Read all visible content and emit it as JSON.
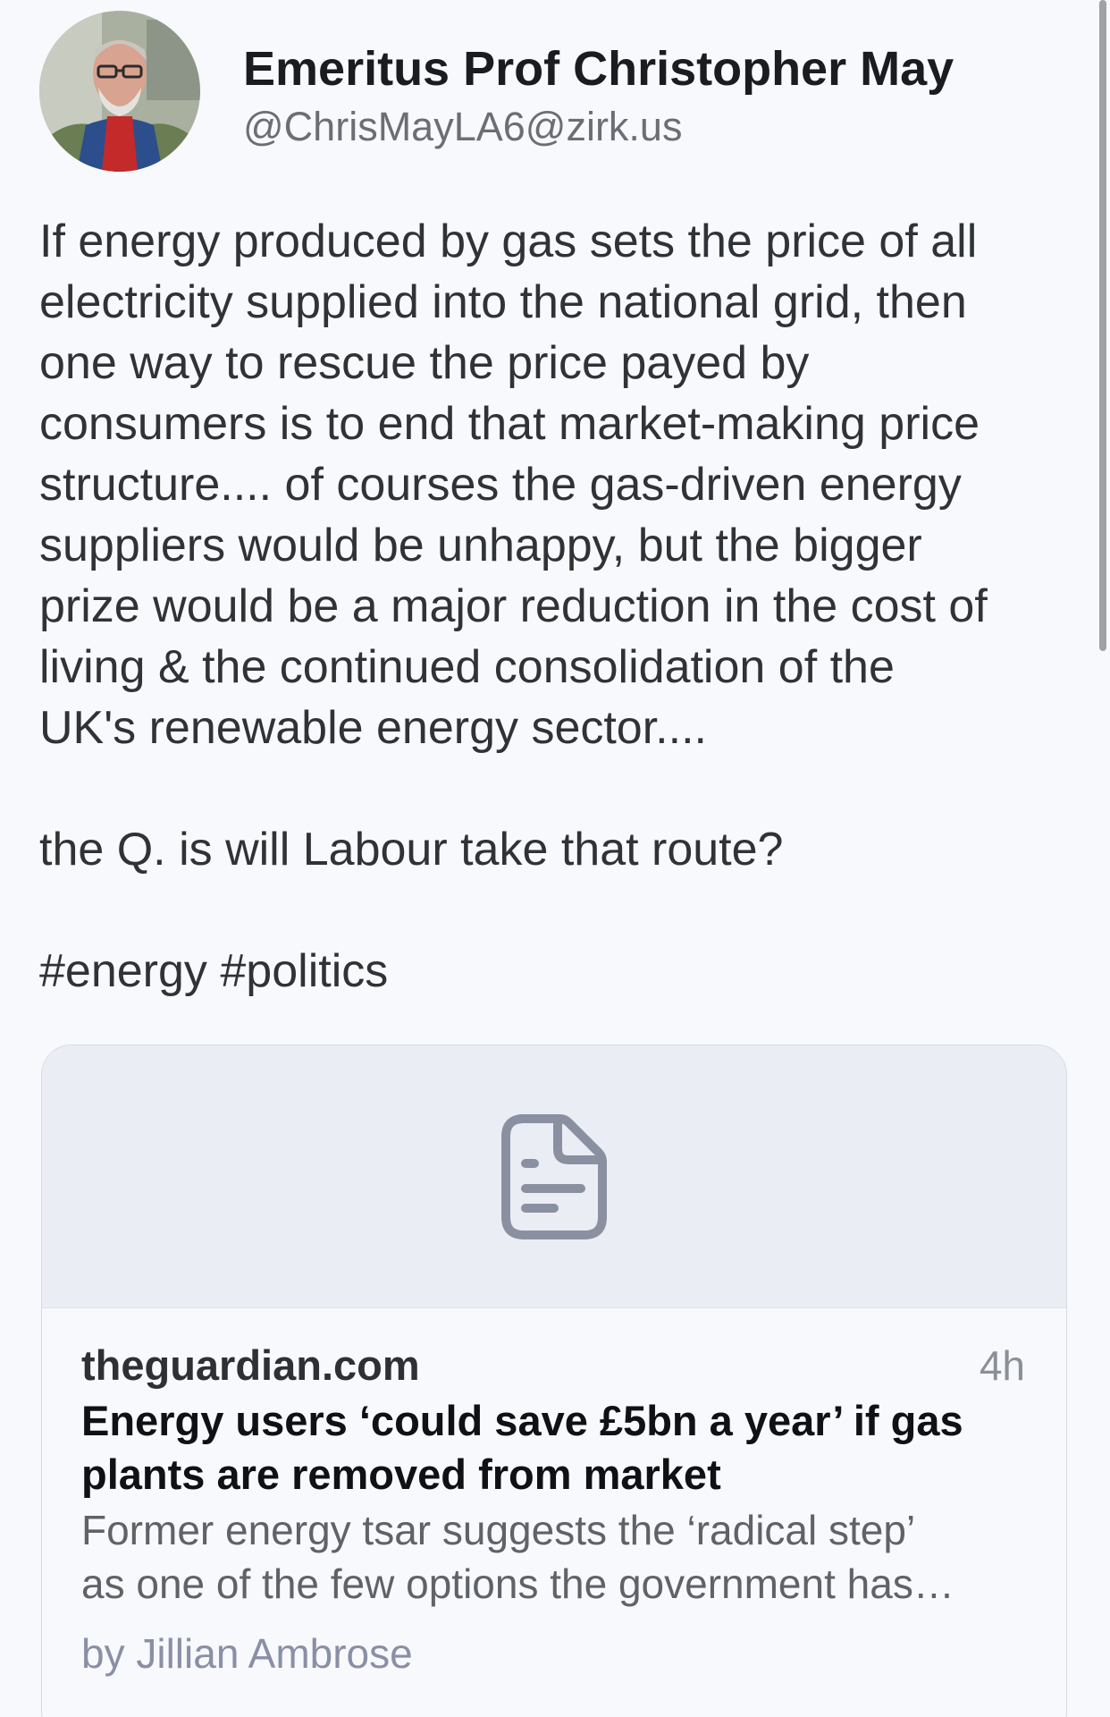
{
  "post": {
    "author": {
      "display_name": "Emeritus Prof Christopher May",
      "handle": "@ChrisMayLA6@zirk.us",
      "avatar_icon": "profile-photo"
    },
    "content": {
      "paragraph_lines": [
        "If energy produced by gas sets the price of all",
        "electricity supplied into the national grid, then",
        "one way to rescue the price payed by",
        "consumers is to end that market-making price",
        "structure.... of courses the gas-driven energy",
        "suppliers would be unhappy, but the bigger",
        "prize would be a major reduction in the cost of",
        "living & the continued consolidation of the",
        "UK's renewable energy sector...."
      ],
      "question": "the Q. is will Labour take that route?",
      "hashtags": [
        "#energy",
        "#politics"
      ]
    },
    "link_card": {
      "image_icon": "document-icon",
      "domain": "theguardian.com",
      "time": "4h",
      "title_lines": [
        "Energy users ‘could save £5bn a year’ if gas",
        "plants are removed from market"
      ],
      "description_lines": [
        "Former energy tsar suggests the ‘radical step’",
        "as one of the few options the government has…"
      ],
      "byline": "by Jillian Ambrose"
    }
  },
  "colors": {
    "background": "#f8f9fc",
    "card_image_bg": "#eaedf4",
    "icon_gray": "#8b90a1",
    "byline": "#8a8fa6"
  }
}
